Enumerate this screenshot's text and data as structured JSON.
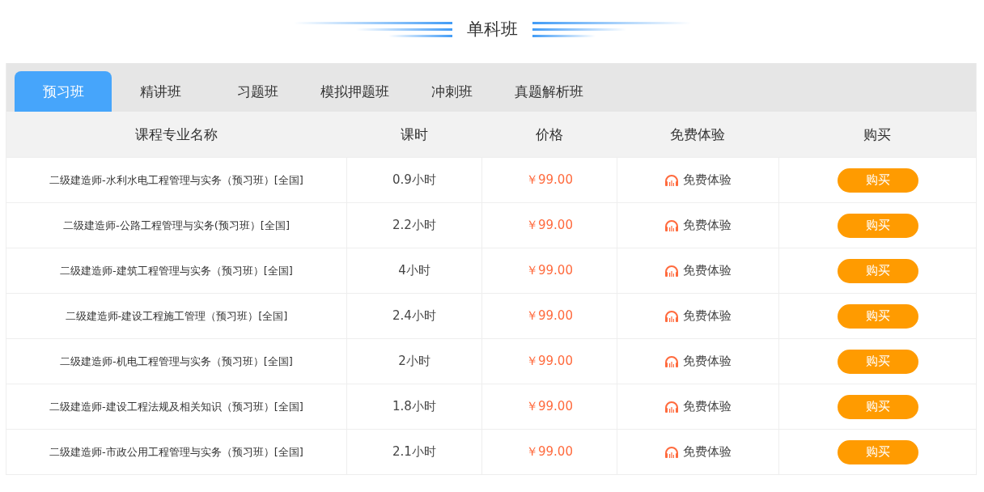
{
  "heading": "单科班",
  "tabs": [
    {
      "label": "预习班",
      "selected": true
    },
    {
      "label": "精讲班",
      "selected": false
    },
    {
      "label": "习题班",
      "selected": false
    },
    {
      "label": "模拟押题班",
      "selected": false
    },
    {
      "label": "冲刺班",
      "selected": false
    },
    {
      "label": "真题解析班",
      "selected": false
    }
  ],
  "table": {
    "columns": [
      "课程专业名称",
      "课时",
      "价格",
      "免费体验",
      "购买"
    ],
    "rows": [
      {
        "name": "二级建造师-水利水电工程管理与实务（预习班）[全国]",
        "hours": "0.9小时",
        "price": "￥99.00",
        "trial": "免费体验",
        "buy": "购买"
      },
      {
        "name": "二级建造师-公路工程管理与实务(预习班）[全国]",
        "hours": "2.2小时",
        "price": "￥99.00",
        "trial": "免费体验",
        "buy": "购买"
      },
      {
        "name": "二级建造师-建筑工程管理与实务（预习班）[全国]",
        "hours": "4小时",
        "price": "￥99.00",
        "trial": "免费体验",
        "buy": "购买"
      },
      {
        "name": "二级建造师-建设工程施工管理（预习班）[全国]",
        "hours": "2.4小时",
        "price": "￥99.00",
        "trial": "免费体验",
        "buy": "购买"
      },
      {
        "name": "二级建造师-机电工程管理与实务（预习班）[全国]",
        "hours": "2小时",
        "price": "￥99.00",
        "trial": "免费体验",
        "buy": "购买"
      },
      {
        "name": "二级建造师-建设工程法规及相关知识（预习班）[全国]",
        "hours": "1.8小时",
        "price": "￥99.00",
        "trial": "免费体验",
        "buy": "购买"
      },
      {
        "name": "二级建造师-市政公用工程管理与实务（预习班）[全国]",
        "hours": "2.1小时",
        "price": "￥99.00",
        "trial": "免费体验",
        "buy": "购买"
      }
    ]
  }
}
